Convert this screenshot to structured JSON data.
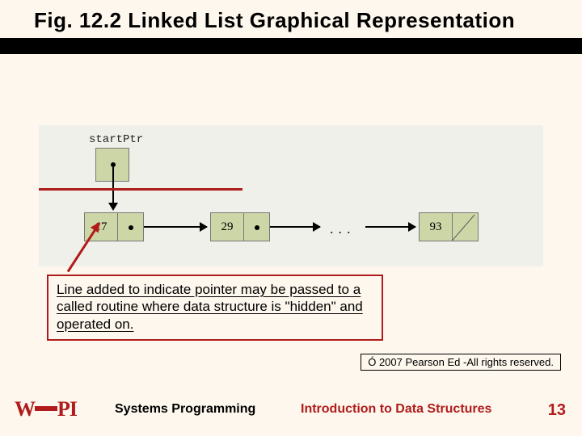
{
  "title": "Fig. 12.2 Linked List Graphical Representation",
  "diagram": {
    "start_label": "startPtr",
    "nodes": [
      "17",
      "29",
      "93"
    ],
    "ellipsis": "..."
  },
  "callout": "Line added to indicate pointer may be passed to a called routine where data structure is \"hidden\" and operated on.",
  "copyright": "Ó 2007 Pearson Ed -All rights reserved.",
  "footer": {
    "left": "Systems Programming",
    "right": "Introduction to Data Structures"
  },
  "page_number": "13",
  "logo_text": "WPI",
  "colors": {
    "accent": "#b01c1c",
    "node_fill": "#cdd6a7",
    "bg": "#fdf7ed"
  }
}
